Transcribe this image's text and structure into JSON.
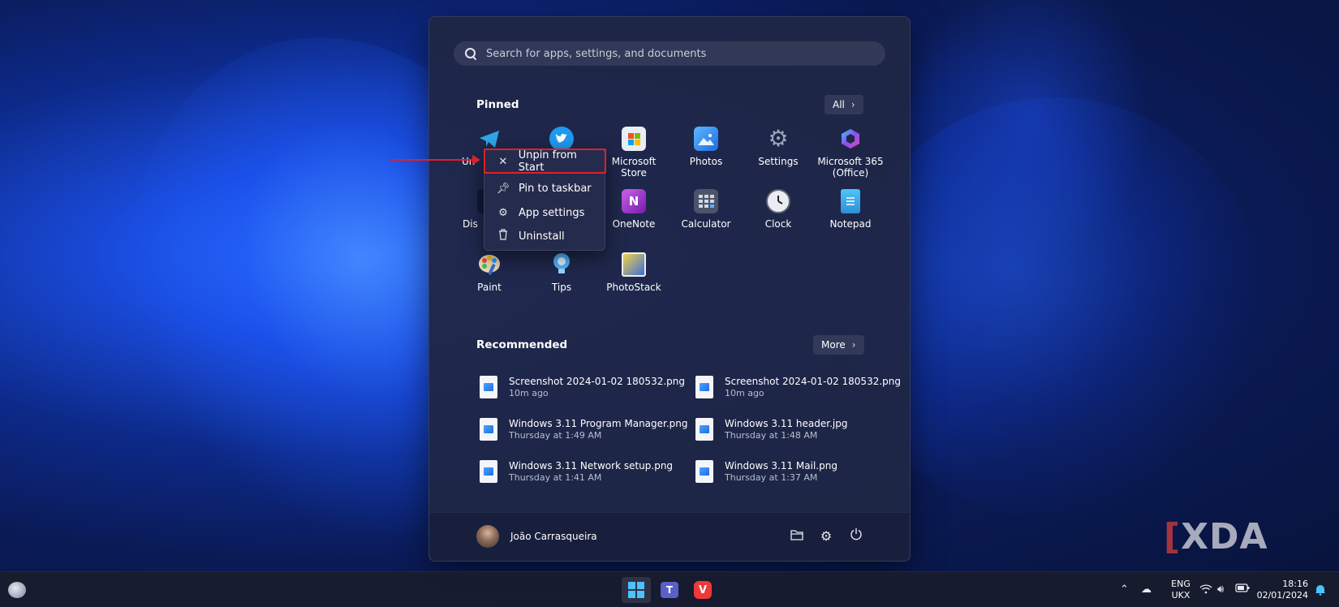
{
  "start_menu": {
    "search_placeholder": "Search for apps, settings, and documents",
    "pinned": {
      "title": "Pinned",
      "all_button": "All",
      "apps": [
        {
          "label": "Unigram",
          "visible_label": "Un",
          "icon": "telegram-icon"
        },
        {
          "label": "Twitter",
          "visible_label": "",
          "icon": "twitter-icon"
        },
        {
          "label": "Microsoft Store",
          "visible_label": "Microsoft Store",
          "icon": "microsoft-store-icon"
        },
        {
          "label": "Photos",
          "visible_label": "Photos",
          "icon": "photos-icon"
        },
        {
          "label": "Settings",
          "visible_label": "Settings",
          "icon": "settings-gear-icon"
        },
        {
          "label": "Microsoft 365 (Office)",
          "visible_label": "Microsoft 365 (Office)",
          "icon": "microsoft-365-icon"
        },
        {
          "label": "Disney+",
          "visible_label": "Dis",
          "icon": "disney-icon"
        },
        {
          "label": "OneNote",
          "visible_label": "OneNote",
          "icon": "onenote-icon"
        },
        {
          "label": "Calculator",
          "visible_label": "Calculator",
          "icon": "calculator-icon"
        },
        {
          "label": "Clock",
          "visible_label": "Clock",
          "icon": "clock-icon"
        },
        {
          "label": "Notepad",
          "visible_label": "Notepad",
          "icon": "notepad-icon"
        },
        {
          "label": "Paint",
          "visible_label": "Paint",
          "icon": "paint-icon"
        },
        {
          "label": "Tips",
          "visible_label": "Tips",
          "icon": "tips-icon"
        },
        {
          "label": "PhotoStack",
          "visible_label": "PhotoStack",
          "icon": "photostack-icon"
        }
      ]
    },
    "recommended": {
      "title": "Recommended",
      "more_button": "More",
      "items": [
        {
          "name": "Screenshot 2024-01-02 180532.png",
          "time": "10m ago"
        },
        {
          "name": "Screenshot 2024-01-02 180532.png",
          "time": "10m ago"
        },
        {
          "name": "Windows 3.11 Program Manager.png",
          "time": "Thursday at 1:49 AM"
        },
        {
          "name": "Windows 3.11 header.jpg",
          "time": "Thursday at 1:48 AM"
        },
        {
          "name": "Windows 3.11 Network setup.png",
          "time": "Thursday at 1:41 AM"
        },
        {
          "name": "Windows 3.11 Mail.png",
          "time": "Thursday at 1:37 AM"
        }
      ]
    },
    "footer": {
      "user_name": "João Carrasqueira"
    }
  },
  "context_menu": {
    "items": [
      {
        "label": "Unpin from Start",
        "icon": "unpin-icon"
      },
      {
        "label": "Pin to taskbar",
        "icon": "pin-icon"
      },
      {
        "label": "App settings",
        "icon": "gear-icon"
      },
      {
        "label": "Uninstall",
        "icon": "trash-icon"
      }
    ]
  },
  "taskbar": {
    "language": "ENG",
    "keyboard": "UKX",
    "time": "18:16",
    "date": "02/01/2024"
  },
  "watermark": "XDA",
  "colors": {
    "accent": "#4cc2ff",
    "highlight": "#e0202a"
  }
}
